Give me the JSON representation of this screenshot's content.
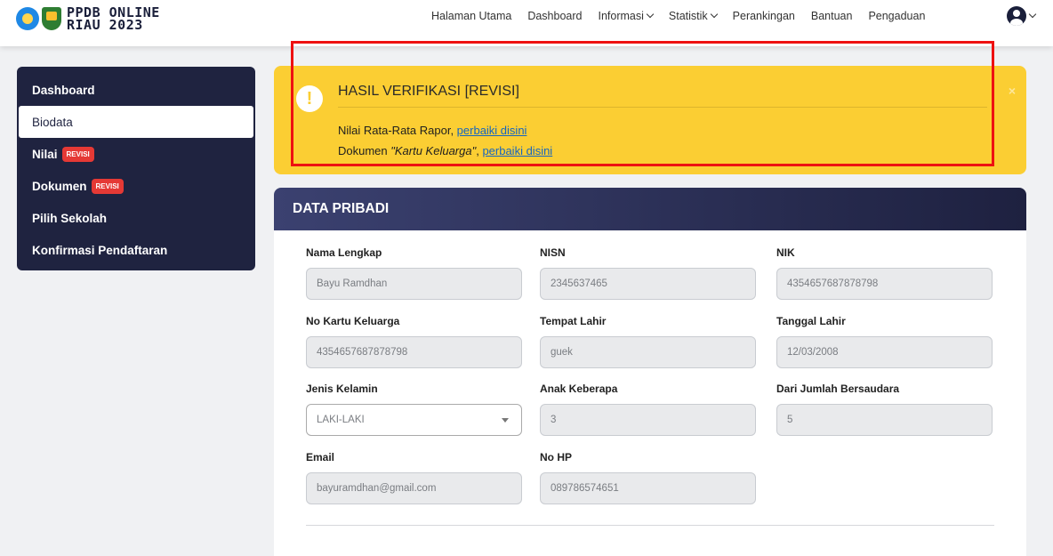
{
  "brand": {
    "line1": "PPDB ONLINE",
    "line2": "RIAU 2023"
  },
  "nav": {
    "items": [
      {
        "label": "Halaman Utama",
        "dropdown": false
      },
      {
        "label": "Dashboard",
        "dropdown": false
      },
      {
        "label": "Informasi",
        "dropdown": true
      },
      {
        "label": "Statistik",
        "dropdown": true
      },
      {
        "label": "Perankingan",
        "dropdown": false
      },
      {
        "label": "Bantuan",
        "dropdown": false
      },
      {
        "label": "Pengaduan",
        "dropdown": false
      }
    ]
  },
  "sidebar": {
    "items": [
      {
        "label": "Dashboard",
        "badge": ""
      },
      {
        "label": "Biodata",
        "badge": "",
        "active": true
      },
      {
        "label": "Nilai",
        "badge": "REVISI"
      },
      {
        "label": "Dokumen",
        "badge": "REVISI"
      },
      {
        "label": "Pilih Sekolah",
        "badge": ""
      },
      {
        "label": "Konfirmasi Pendaftaran",
        "badge": ""
      }
    ]
  },
  "alert": {
    "icon": "!",
    "title": "HASIL VERIFIKASI [REVISI]",
    "line1_text": "Nilai Rata-Rata Rapor, ",
    "line1_link": "perbaiki disini",
    "line2_prefix": "Dokumen ",
    "line2_doc": "\"Kartu Keluarga\"",
    "line2_sep": ", ",
    "line2_link": "perbaiki disini",
    "close": "×"
  },
  "card": {
    "title": "DATA PRIBADI",
    "fields": {
      "nama": {
        "label": "Nama Lengkap",
        "value": "Bayu Ramdhan"
      },
      "nisn": {
        "label": "NISN",
        "value": "2345637465"
      },
      "nik": {
        "label": "NIK",
        "value": "4354657687878798"
      },
      "kk": {
        "label": "No Kartu Keluarga",
        "value": "4354657687878798"
      },
      "tempat": {
        "label": "Tempat Lahir",
        "value": "guek"
      },
      "tanggal": {
        "label": "Tanggal Lahir",
        "value": "12/03/2008"
      },
      "gender": {
        "label": "Jenis Kelamin",
        "value": "LAKI-LAKI"
      },
      "anak": {
        "label": "Anak Keberapa",
        "value": "3"
      },
      "saudara": {
        "label": "Dari Jumlah Bersaudara",
        "value": "5"
      },
      "email": {
        "label": "Email",
        "value": "bayuramdhan@gmail.com"
      },
      "hp": {
        "label": "No HP",
        "value": "089786574651"
      }
    }
  },
  "colors": {
    "accent": "#fbce33",
    "sidebar": "#1f2340",
    "badge": "#e53935",
    "highlight": "#ee1111"
  }
}
